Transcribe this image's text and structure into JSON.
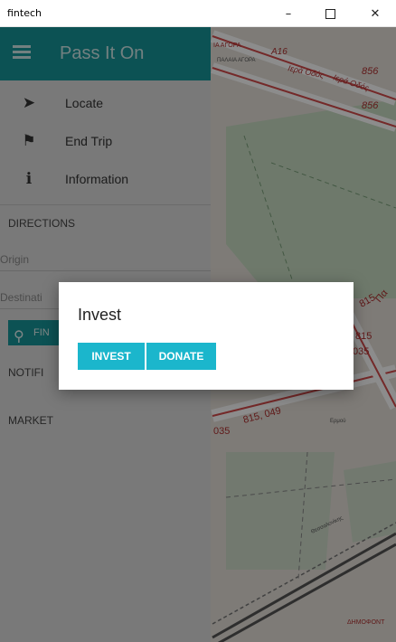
{
  "window": {
    "title": "fintech",
    "minimize_glyph": "–",
    "close_glyph": "✕"
  },
  "header": {
    "app_title": "Pass It On",
    "menu_icon": "hamburger-icon",
    "color": "#16969a"
  },
  "nav": {
    "items": [
      {
        "label": "Locate",
        "icon": "navigation-arrow-icon"
      },
      {
        "label": "End Trip",
        "icon": "flag-icon"
      },
      {
        "label": "Information",
        "icon": "info-icon"
      }
    ]
  },
  "directions": {
    "section_label": "DIRECTIONS",
    "origin_placeholder": "Origin",
    "destination_placeholder": "Destinati",
    "find_label": "FIN"
  },
  "sections": {
    "notifications_label": "NOTIFI",
    "market_label": "MARKET"
  },
  "dialog": {
    "title": "Invest",
    "invest_label": "INVEST",
    "donate_label": "DONATE",
    "button_color": "#1bb6cc"
  },
  "map": {
    "labels": [
      "ΙΑ ΑΓΟΡΑ",
      "Α16",
      "ΠΑΛΑΙΑ ΑΓΟΡΑ",
      "Ιερά Οδός",
      "Ιερά Οδός",
      "856",
      "856",
      "815",
      "815",
      "Πα",
      "035",
      "815, 049",
      "Ερμού",
      "035",
      "Θεσσαλονίκης",
      "ΔΗΜΟΦΟΝΤ"
    ]
  }
}
